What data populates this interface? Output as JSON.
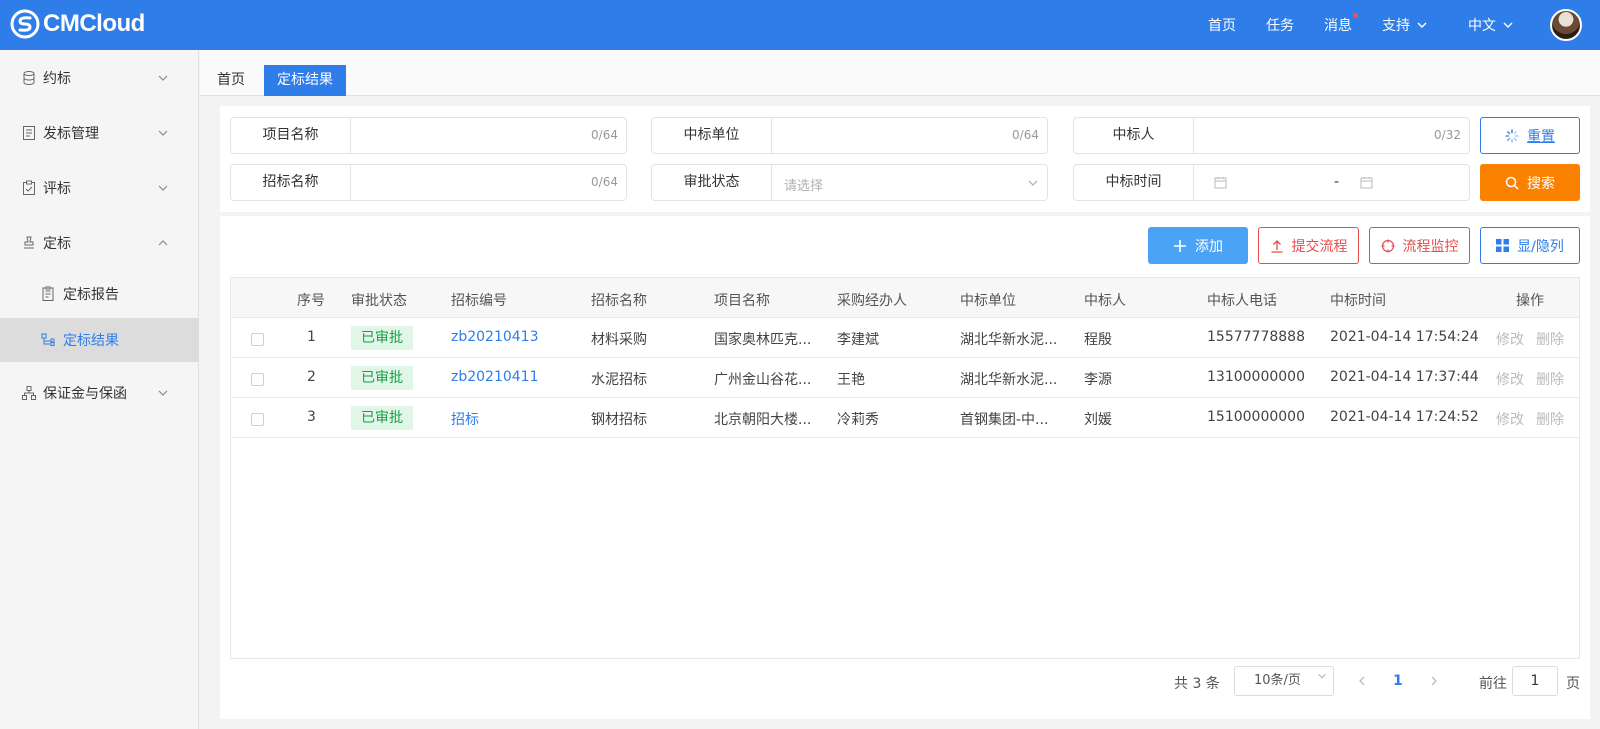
{
  "app": {
    "brand": "CMCloud",
    "accent": "#2f7de9"
  },
  "topnav": {
    "home": "首页",
    "tasks": "任务",
    "messages": "消息",
    "support": "支持",
    "language": "中文"
  },
  "sidebar": {
    "items": [
      {
        "label": "约标",
        "icon": "database-icon"
      },
      {
        "label": "发标管理",
        "icon": "document-icon"
      },
      {
        "label": "评标",
        "icon": "clipboard-check-icon"
      },
      {
        "label": "定标",
        "icon": "stamp-icon"
      },
      {
        "label": "保证金与保函",
        "icon": "org-chart-icon"
      }
    ],
    "sub_items": [
      {
        "label": "定标报告",
        "icon": "report-icon"
      },
      {
        "label": "定标结果",
        "icon": "flow-icon"
      }
    ]
  },
  "tabs": [
    {
      "label": "首页"
    },
    {
      "label": "定标结果"
    }
  ],
  "filters": {
    "project_name": {
      "label": "项目名称",
      "count": "0/64"
    },
    "winning_unit": {
      "label": "中标单位",
      "count": "0/64"
    },
    "winner": {
      "label": "中标人",
      "count": "0/32"
    },
    "tender_name": {
      "label": "招标名称",
      "count": "0/64"
    },
    "approval_status": {
      "label": "审批状态",
      "placeholder": "请选择"
    },
    "winning_time": {
      "label": "中标时间",
      "separator": "-"
    }
  },
  "buttons": {
    "reset": "重置",
    "search": "搜索",
    "add": "添加",
    "submit_flow": "提交流程",
    "monitor_flow": "流程监控",
    "toggle_cols": "显/隐列"
  },
  "table": {
    "headers": [
      "序号",
      "审批状态",
      "招标编号",
      "招标名称",
      "项目名称",
      "采购经办人",
      "中标单位",
      "中标人",
      "中标人电话",
      "中标时间",
      "操作"
    ],
    "rows": [
      {
        "no": "1",
        "status": "已审批",
        "code": "zb20210413",
        "tender": "材料采购",
        "project": "国家奥林匹克...",
        "buyer": "李建斌",
        "unit": "湖北华新水泥...",
        "winner": "程殷",
        "phone": "15577778888",
        "time": "2021-04-14 17:54:24",
        "edit": "修改",
        "delete": "删除"
      },
      {
        "no": "2",
        "status": "已审批",
        "code": "zb20210411",
        "tender": "水泥招标",
        "project": "广州金山谷花...",
        "buyer": "王艳",
        "unit": "湖北华新水泥...",
        "winner": "李源",
        "phone": "13100000000",
        "time": "2021-04-14 17:37:44",
        "edit": "修改",
        "delete": "删除"
      },
      {
        "no": "3",
        "status": "已审批",
        "code": "招标",
        "tender": "钢材招标",
        "project": "北京朝阳大楼...",
        "buyer": "冷莉秀",
        "unit": "首钢集团-中...",
        "winner": "刘媛",
        "phone": "15100000000",
        "time": "2021-04-14 17:24:52",
        "edit": "修改",
        "delete": "删除"
      }
    ]
  },
  "pagination": {
    "total": "共 3 条",
    "page_size": "10条/页",
    "current": "1",
    "goto_prefix": "前往",
    "goto_value": "1",
    "goto_suffix": "页"
  }
}
